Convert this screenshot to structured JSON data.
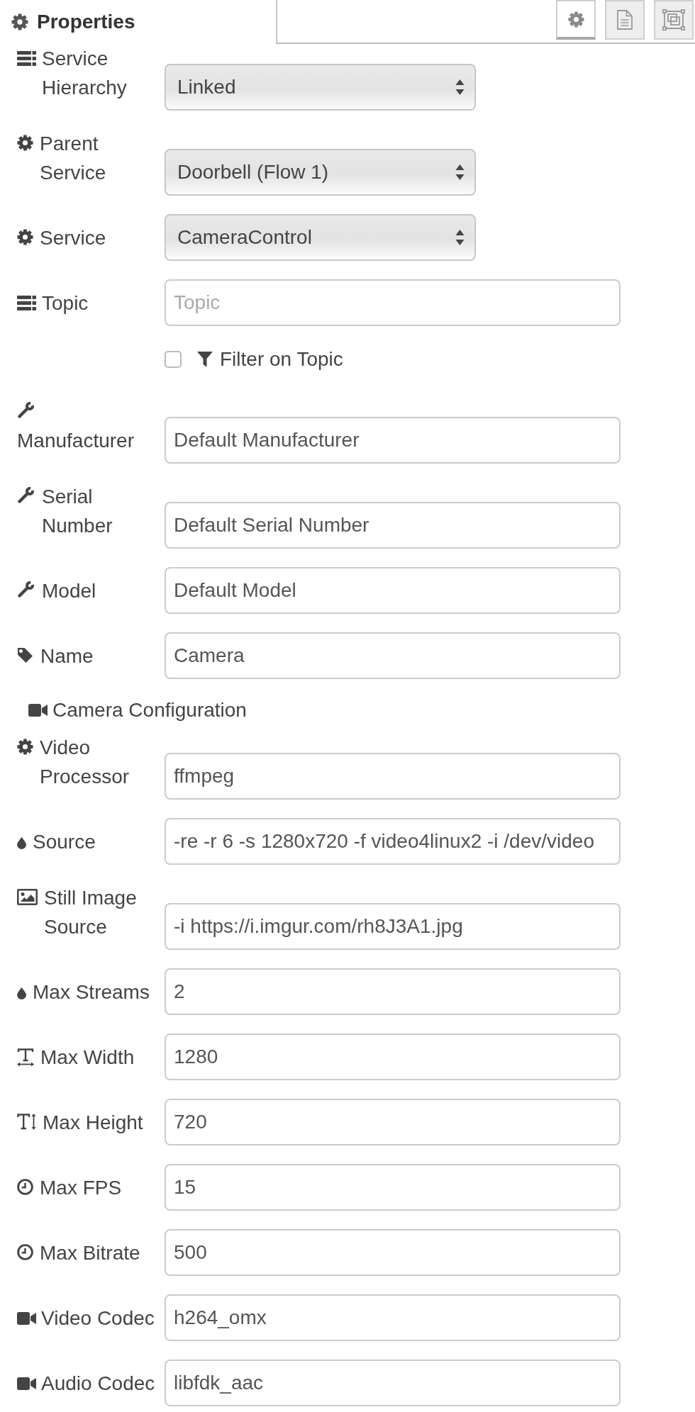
{
  "panel": {
    "title": "Properties"
  },
  "tabs": [
    {
      "kind": "settings",
      "selected": true
    },
    {
      "kind": "document",
      "selected": false
    },
    {
      "kind": "frame",
      "selected": false
    }
  ],
  "form": {
    "rows": [
      {
        "kind": "select",
        "label": "Service Hierarchy",
        "value": "Linked"
      },
      {
        "kind": "select",
        "label": "Parent Service",
        "value": "Doorbell (Flow 1)"
      },
      {
        "kind": "select",
        "label": "Service",
        "value": "CameraControl"
      },
      {
        "kind": "text",
        "label": "Topic",
        "placeholder": "Topic"
      },
      {
        "kind": "checkbox",
        "label": "Filter on Topic",
        "checked": false
      },
      {
        "kind": "text",
        "label": "Manufacturer",
        "value": "Default Manufacturer"
      },
      {
        "kind": "text",
        "label": "Serial Number",
        "value": "Default Serial Number"
      },
      {
        "kind": "text",
        "label": "Model",
        "value": "Default Model"
      },
      {
        "kind": "text",
        "label": "Name",
        "value": "Camera"
      },
      {
        "kind": "heading",
        "label": "Camera Configuration"
      },
      {
        "kind": "text",
        "label": "Video Processor",
        "value": "ffmpeg"
      },
      {
        "kind": "text",
        "label": "Source",
        "value": "-re -r 6 -s 1280x720 -f video4linux2 -i /dev/video"
      },
      {
        "kind": "text",
        "label": "Still Image Source",
        "value": "-i https://i.imgur.com/rh8J3A1.jpg"
      },
      {
        "kind": "text",
        "label": "Max Streams",
        "value": "2"
      },
      {
        "kind": "text",
        "label": "Max Width",
        "value": "1280"
      },
      {
        "kind": "text",
        "label": "Max Height",
        "value": "720"
      },
      {
        "kind": "text",
        "label": "Max FPS",
        "value": "15"
      },
      {
        "kind": "text",
        "label": "Max Bitrate",
        "value": "500"
      },
      {
        "kind": "text",
        "label": "Video Codec",
        "value": "h264_omx"
      },
      {
        "kind": "text",
        "label": "Audio Codec",
        "value": "libfdk_aac"
      }
    ]
  }
}
